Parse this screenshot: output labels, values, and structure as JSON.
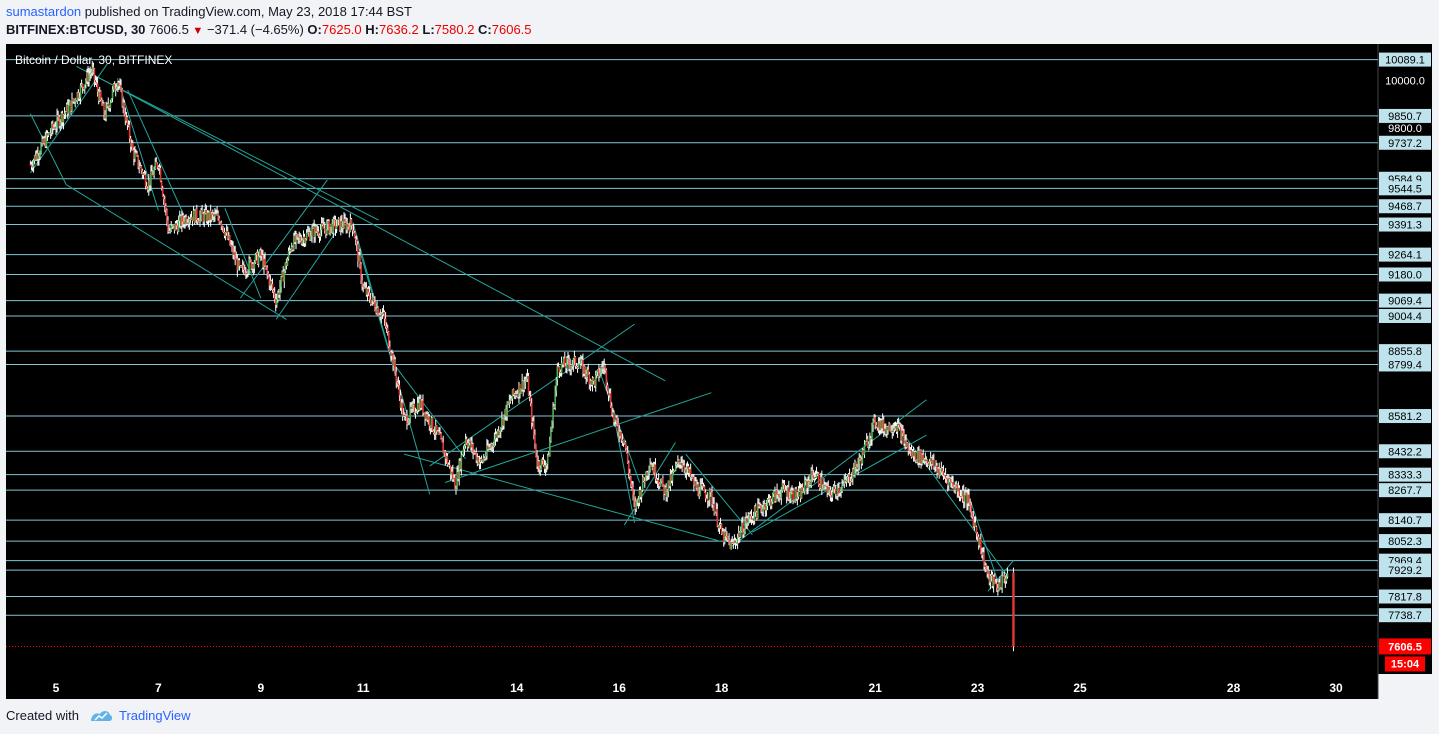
{
  "header": {
    "author": "sumastardon",
    "published_text": "published on TradingView.com, May 23, 2018 17:44 BST",
    "symbol": "BITFINEX:BTCUSD, 30",
    "last": "7606.5",
    "change": "−371.4 (−4.65%)",
    "o_label": "O:",
    "o": "7625.0",
    "h_label": "H:",
    "h": "7636.2",
    "l_label": "L:",
    "l": "7580.2",
    "c_label": "C:",
    "c": "7606.5"
  },
  "footer": {
    "created_with": "Created with",
    "brand": "TradingView"
  },
  "colors": {
    "background": "#000000",
    "level_line": "#7fc6d6",
    "trend_line": "#22a59a",
    "axis_label_bg": "#bfe3ec",
    "price_tag": "#ff0000",
    "candle_up": "#4caf50",
    "candle_down": "#e53935",
    "wick": "#ffffff"
  },
  "chart_data": {
    "type": "candlestick",
    "title": "Bitcoin / Dollar, 30, BITFINEX",
    "x_ticks": [
      "5",
      "7",
      "9",
      "11",
      "14",
      "16",
      "18",
      "21",
      "23",
      "25",
      "28",
      "30"
    ],
    "y_range": [
      7490,
      10155
    ],
    "price_levels": [
      "10089.1",
      "9850.7",
      "9737.2",
      "9584.9",
      "9544.5",
      "9468.7",
      "9391.3",
      "9264.1",
      "9180.0",
      "9069.4",
      "9004.4",
      "8855.8",
      "8799.4",
      "8581.2",
      "8432.2",
      "8333.3",
      "8267.7",
      "8140.7",
      "8052.3",
      "7969.4",
      "7929.2",
      "7817.8",
      "7738.7"
    ],
    "extra_axis_labels": [
      "10000.0",
      "9800.0"
    ],
    "current_price": "7606.5",
    "countdown": "15:04",
    "price_path": [
      {
        "day": 4.5,
        "price": 9645
      },
      {
        "day": 5.0,
        "price": 9820
      },
      {
        "day": 5.3,
        "price": 9900
      },
      {
        "day": 5.7,
        "price": 10045
      },
      {
        "day": 5.95,
        "price": 9850
      },
      {
        "day": 6.2,
        "price": 10010
      },
      {
        "day": 6.5,
        "price": 9700
      },
      {
        "day": 6.8,
        "price": 9560
      },
      {
        "day": 7.0,
        "price": 9660
      },
      {
        "day": 7.2,
        "price": 9360
      },
      {
        "day": 7.6,
        "price": 9430
      },
      {
        "day": 8.2,
        "price": 9420
      },
      {
        "day": 8.6,
        "price": 9190
      },
      {
        "day": 9.0,
        "price": 9260
      },
      {
        "day": 9.3,
        "price": 9070
      },
      {
        "day": 9.6,
        "price": 9310
      },
      {
        "day": 10.0,
        "price": 9360
      },
      {
        "day": 10.5,
        "price": 9390
      },
      {
        "day": 10.8,
        "price": 9390
      },
      {
        "day": 11.0,
        "price": 9120
      },
      {
        "day": 11.4,
        "price": 9000
      },
      {
        "day": 11.6,
        "price": 8800
      },
      {
        "day": 11.8,
        "price": 8560
      },
      {
        "day": 12.1,
        "price": 8640
      },
      {
        "day": 12.5,
        "price": 8480
      },
      {
        "day": 12.8,
        "price": 8290
      },
      {
        "day": 13.0,
        "price": 8490
      },
      {
        "day": 13.3,
        "price": 8380
      },
      {
        "day": 13.6,
        "price": 8500
      },
      {
        "day": 13.9,
        "price": 8660
      },
      {
        "day": 14.2,
        "price": 8740
      },
      {
        "day": 14.4,
        "price": 8380
      },
      {
        "day": 14.6,
        "price": 8380
      },
      {
        "day": 14.8,
        "price": 8790
      },
      {
        "day": 15.2,
        "price": 8810
      },
      {
        "day": 15.5,
        "price": 8720
      },
      {
        "day": 15.7,
        "price": 8800
      },
      {
        "day": 15.9,
        "price": 8560
      },
      {
        "day": 16.1,
        "price": 8480
      },
      {
        "day": 16.3,
        "price": 8190
      },
      {
        "day": 16.6,
        "price": 8390
      },
      {
        "day": 16.9,
        "price": 8260
      },
      {
        "day": 17.2,
        "price": 8400
      },
      {
        "day": 17.5,
        "price": 8280
      },
      {
        "day": 17.8,
        "price": 8240
      },
      {
        "day": 18.0,
        "price": 8080
      },
      {
        "day": 18.2,
        "price": 8030
      },
      {
        "day": 18.5,
        "price": 8140
      },
      {
        "day": 18.8,
        "price": 8200
      },
      {
        "day": 19.2,
        "price": 8270
      },
      {
        "day": 19.5,
        "price": 8240
      },
      {
        "day": 19.8,
        "price": 8340
      },
      {
        "day": 20.1,
        "price": 8250
      },
      {
        "day": 20.4,
        "price": 8290
      },
      {
        "day": 20.7,
        "price": 8390
      },
      {
        "day": 21.0,
        "price": 8560
      },
      {
        "day": 21.2,
        "price": 8530
      },
      {
        "day": 21.4,
        "price": 8550
      },
      {
        "day": 21.7,
        "price": 8420
      },
      {
        "day": 22.0,
        "price": 8400
      },
      {
        "day": 22.4,
        "price": 8320
      },
      {
        "day": 22.8,
        "price": 8230
      },
      {
        "day": 23.0,
        "price": 8080
      },
      {
        "day": 23.2,
        "price": 7900
      },
      {
        "day": 23.4,
        "price": 7860
      },
      {
        "day": 23.6,
        "price": 7920
      },
      {
        "day": 23.7,
        "price": 7606.5
      }
    ]
  }
}
